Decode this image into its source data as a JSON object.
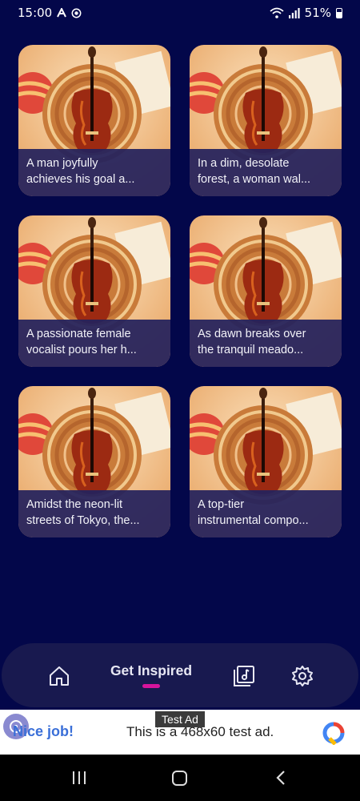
{
  "status_bar": {
    "time": "15:00",
    "left_icons": [
      "a-icon",
      "record-icon"
    ],
    "battery": "51%",
    "right_icons": [
      "wifi-icon",
      "signal-icon",
      "battery-icon"
    ]
  },
  "cards": [
    {
      "line1": "A man joyfully",
      "line2": "achieves his goal a..."
    },
    {
      "line1": "In a dim, desolate",
      "line2": "forest, a woman wal..."
    },
    {
      "line1": "A passionate female",
      "line2": "vocalist pours her h..."
    },
    {
      "line1": "As dawn breaks over",
      "line2": "the tranquil meado..."
    },
    {
      "line1": "Amidst the neon-lit",
      "line2": "streets of Tokyo, the..."
    },
    {
      "line1": "A top-tier",
      "line2": "instrumental compo..."
    }
  ],
  "bottom_nav": {
    "active_label": "Get Inspired",
    "items": [
      "home-icon",
      "get-inspired",
      "music-library-icon",
      "settings-icon"
    ]
  },
  "ad": {
    "label": "Test Ad",
    "nice": "Nice job!",
    "text": "This is a 468x60 test ad."
  },
  "colors": {
    "background": "#03074a",
    "nav_background": "#18194f",
    "accent": "#d6149c"
  }
}
